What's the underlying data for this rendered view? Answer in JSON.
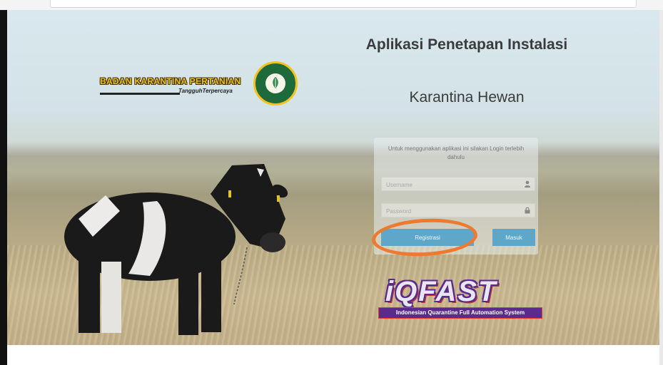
{
  "logo": {
    "title": "BADAN KARANTINA PERTANIAN",
    "tagline": "TangguhTerpercaya"
  },
  "header": {
    "title": "Aplikasi Penetapan Instalasi",
    "subtitle": "Karantina Hewan"
  },
  "login": {
    "hint": "Untuk menggunakan aplikasi ini silakan Login terlebih dahulu",
    "username_placeholder": "Username",
    "password_placeholder": "Password",
    "register_label": "Registrasi",
    "login_label": "Masuk"
  },
  "brand": {
    "name": "iQFAST",
    "tagline": "Indonesian Quarantine Full Automation System"
  },
  "colors": {
    "button": "#5ea7c8",
    "annotation": "#ec7a30",
    "logo_gold": "#f3c21a",
    "emblem_green": "#1f6a3a"
  }
}
